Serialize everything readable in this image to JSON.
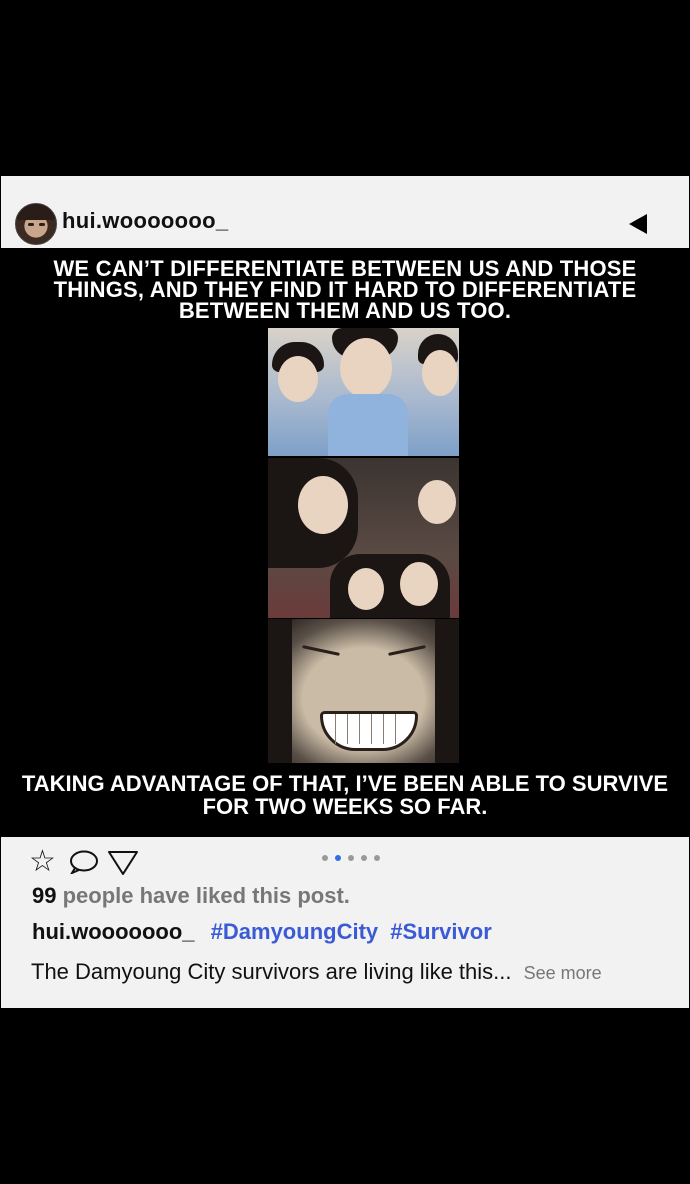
{
  "post": {
    "username": "hui.wooooooo_",
    "caption_top": "We can’t differentiate between us and those things, and they find it hard to differentiate between them and us too.",
    "caption_bottom": "Taking advantage of that, I’ve been able to survive for two weeks so far.",
    "likes_count": "99",
    "likes_text": "people have liked this post.",
    "caption_user": "hui.wooooooo_",
    "hashtags": [
      "#DamyoungCity",
      "#Survivor"
    ],
    "description": "The Damyoung City survivors are living like this...",
    "see_more": "See more",
    "carousel": {
      "count": 5,
      "active_index": 2
    }
  },
  "icons": {
    "star": "star-icon",
    "comment": "comment-icon",
    "share": "share-icon",
    "back": "back-arrow-icon"
  },
  "colors": {
    "card_bg": "#f2f2f2",
    "hashtag": "#3b5bd6",
    "active_dot": "#2f6fe0"
  }
}
